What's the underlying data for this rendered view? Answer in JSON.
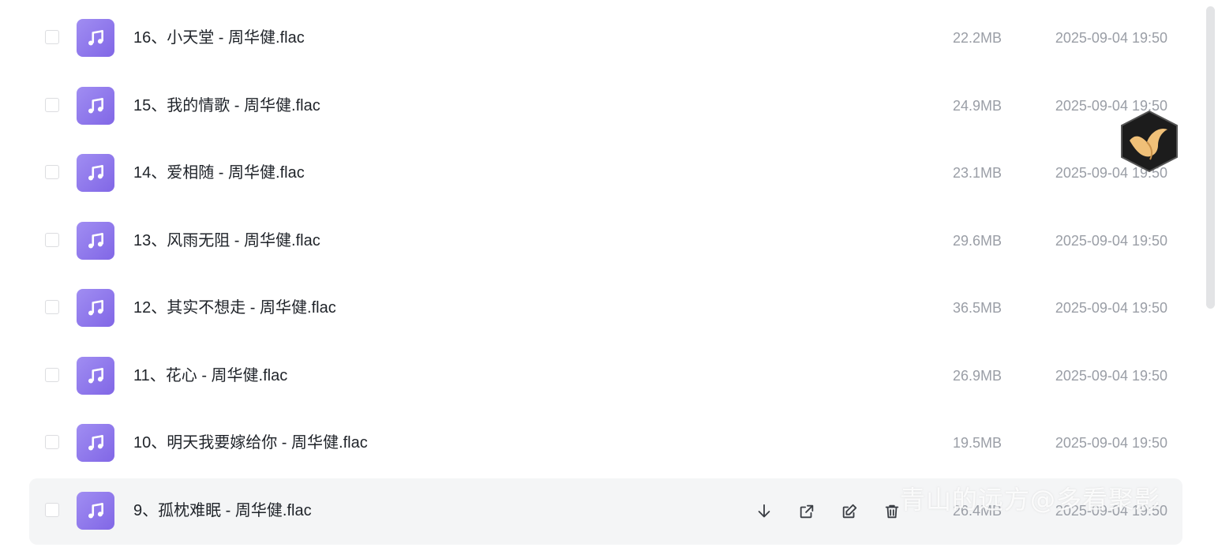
{
  "files": [
    {
      "name": "16、小天堂 - 周华健.flac",
      "size": "22.2MB",
      "date": "2025-09-04 19:50"
    },
    {
      "name": "15、我的情歌 - 周华健.flac",
      "size": "24.9MB",
      "date": "2025-09-04 19:50"
    },
    {
      "name": "14、爱相随 - 周华健.flac",
      "size": "23.1MB",
      "date": "2025-09-04 19:50"
    },
    {
      "name": "13、风雨无阻 - 周华健.flac",
      "size": "29.6MB",
      "date": "2025-09-04 19:50"
    },
    {
      "name": "12、其实不想走 - 周华健.flac",
      "size": "36.5MB",
      "date": "2025-09-04 19:50"
    },
    {
      "name": "11、花心 - 周华健.flac",
      "size": "26.9MB",
      "date": "2025-09-04 19:50"
    },
    {
      "name": "10、明天我要嫁给你 - 周华健.flac",
      "size": "19.5MB",
      "date": "2025-09-04 19:50"
    },
    {
      "name": "9、孤枕难眠 - 周华健.flac",
      "size": "26.4MB",
      "date": "2025-09-04 19:50"
    }
  ],
  "row_actions": {
    "download_icon": "download-icon",
    "share_icon": "share-icon",
    "rename_icon": "edit-icon",
    "delete_icon": "trash-icon"
  },
  "file_icon": "music-note-icon",
  "watermark": "青山的远方@多看聚影",
  "colors": {
    "icon_gradient_start": "#a08df2",
    "icon_gradient_end": "#8167e6",
    "hover_row_bg": "#f4f5f6",
    "name_text": "#1f2329",
    "meta_text": "#9a9ea6"
  }
}
